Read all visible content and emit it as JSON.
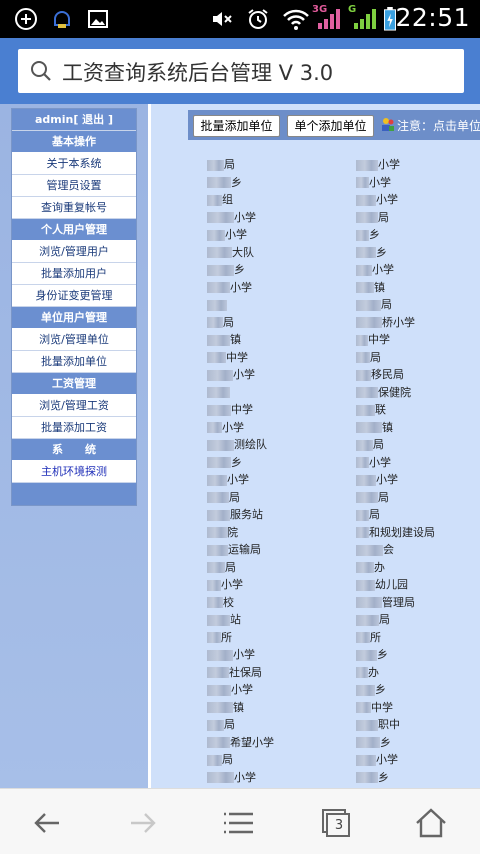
{
  "statusbar": {
    "time": "22:51",
    "net1": "3G",
    "net2": "G"
  },
  "urlbar": {
    "title": "工资查询系统后台管理 V 3.0"
  },
  "menu": {
    "user": "admin[ 退出 ]",
    "sections": [
      {
        "title": "基本操作",
        "items": [
          "关于本系统",
          "管理员设置",
          "查询重复帐号"
        ]
      },
      {
        "title": "个人用户管理",
        "items": [
          "浏览/管理用户",
          "批量添加用户",
          "身份证变更管理"
        ]
      },
      {
        "title": "单位用户管理",
        "items": [
          "浏览/管理单位",
          "批量添加单位"
        ]
      },
      {
        "title": "工资管理",
        "items": [
          "浏览/管理工资",
          "批量添加工资"
        ]
      },
      {
        "title": "系　　统",
        "items": [
          "主机环境探测"
        ]
      }
    ]
  },
  "toolbar": {
    "batch_add_label": "批量添加单位",
    "single_add_label": "单个添加单位",
    "note": "注意：点击单位"
  },
  "units": {
    "left": [
      "局",
      "乡",
      "组",
      "小学",
      "小学",
      "大队",
      "乡",
      "小学",
      "",
      "局",
      "镇",
      "中学",
      "小学",
      "",
      "中学",
      "小学",
      "测绘队",
      "乡",
      "小学",
      "局",
      "服务站",
      "院",
      "运输局",
      "局",
      "小学",
      "校",
      "站",
      "所",
      "小学",
      "社保局",
      "小学",
      "镇",
      "局",
      "希望小学",
      "局",
      "小学"
    ],
    "right": [
      "小学",
      "小学",
      "小学",
      "局",
      "乡",
      "乡",
      "小学",
      "镇",
      "局",
      "桥小学",
      "中学",
      "局",
      "移民局",
      "保健院",
      "联",
      "镇",
      "局",
      "小学",
      "小学",
      "局",
      "局",
      "和规划建设局",
      "会",
      "办",
      "幼儿园",
      "管理局",
      "局",
      "所",
      "乡",
      "办",
      "乡",
      "中学",
      "职中",
      "乡",
      "小学",
      "乡"
    ]
  },
  "bottomnav": {
    "tab_count": "3"
  }
}
